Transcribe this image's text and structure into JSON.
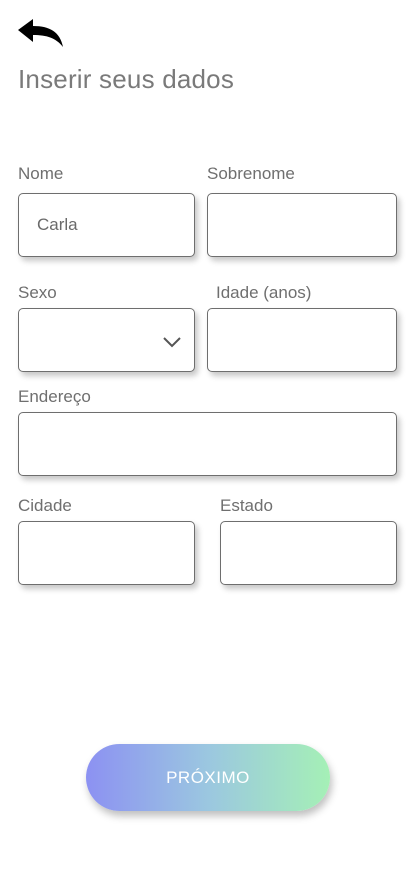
{
  "header": {
    "back_icon": "back-arrow-icon",
    "title": "Inserir seus dados"
  },
  "form": {
    "nome": {
      "label": "Nome",
      "value": "Carla"
    },
    "sobrenome": {
      "label": "Sobrenome",
      "value": ""
    },
    "sexo": {
      "label": "Sexo",
      "value": "",
      "icon": "chevron-down-icon"
    },
    "idade": {
      "label": "Idade (anos)",
      "value": ""
    },
    "endereco": {
      "label": "Endereço",
      "value": ""
    },
    "cidade": {
      "label": "Cidade",
      "value": ""
    },
    "estado": {
      "label": "Estado",
      "value": ""
    }
  },
  "actions": {
    "next_label": "PRÓXIMO"
  },
  "colors": {
    "gradient_start": "#8c91f2",
    "gradient_end": "#a5f0b6",
    "text": "#777777"
  }
}
